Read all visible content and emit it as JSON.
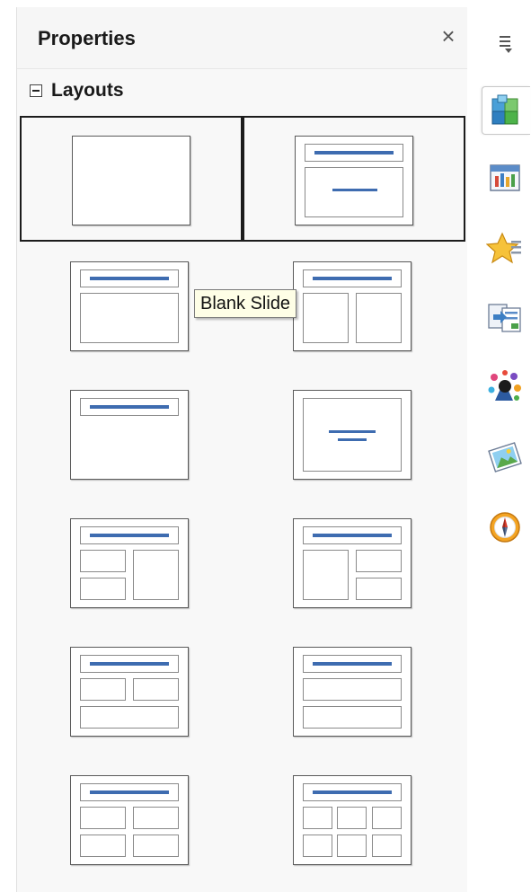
{
  "panel": {
    "title": "Properties",
    "close_glyph": "×",
    "menu_icon": "sidebar-menu-icon"
  },
  "layouts": {
    "section_label": "Layouts",
    "collapse_state": "expanded",
    "selected": [
      "blank",
      "title-slide"
    ],
    "items": [
      {
        "id": "blank"
      },
      {
        "id": "title-slide"
      },
      {
        "id": "title-content"
      },
      {
        "id": "title-two-content"
      },
      {
        "id": "title-only"
      },
      {
        "id": "centered-text"
      },
      {
        "id": "title-2content-and-content"
      },
      {
        "id": "title-content-and-2content"
      },
      {
        "id": "title-2content-over-content"
      },
      {
        "id": "title-content-over-content"
      },
      {
        "id": "title-4content"
      },
      {
        "id": "title-6content"
      }
    ]
  },
  "tooltip": {
    "text": "Blank Slide"
  },
  "tabs": [
    {
      "icon": "properties-icon",
      "active": true
    },
    {
      "icon": "master-slides-icon",
      "active": false
    },
    {
      "icon": "custom-animation-icon",
      "active": false
    },
    {
      "icon": "slide-transition-icon",
      "active": false
    },
    {
      "icon": "styles-icon",
      "active": false
    },
    {
      "icon": "gallery-icon",
      "active": false
    },
    {
      "icon": "navigator-icon",
      "active": false
    }
  ],
  "colors": {
    "title_line": "#3e6cb0",
    "tooltip_bg": "#fefee6"
  }
}
